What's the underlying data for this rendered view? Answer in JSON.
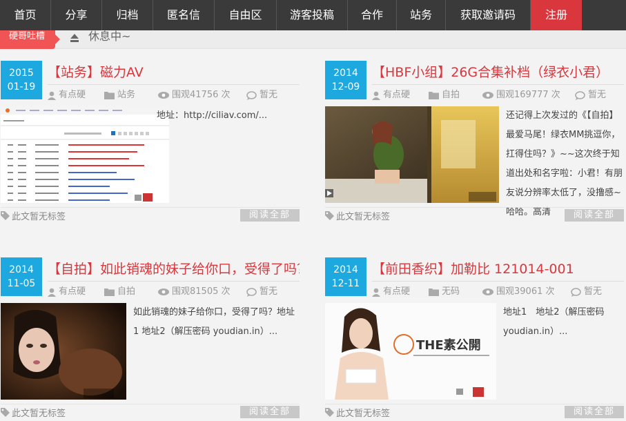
{
  "nav": {
    "items": [
      "首页",
      "分享",
      "归档",
      "匿名信",
      "自由区",
      "游客投稿",
      "合作",
      "站务",
      "获取邀请码",
      "注册"
    ]
  },
  "notice": {
    "tag": "硬哥吐槽",
    "text": "休息中~"
  },
  "labels": {
    "no_tags": "此文暂无标签",
    "read_all": "阅读全部"
  },
  "posts": [
    {
      "year": "2015",
      "day": "01-19",
      "title": "【站务】磁力AV",
      "author": "有点硬",
      "category": "站务",
      "views": "围观41756 次",
      "comments": "暂无",
      "excerpt": "地址：http://ciliav.com/..."
    },
    {
      "year": "2014",
      "day": "12-09",
      "title": "【HBF小组】26G合集补档（绿衣小君）",
      "author": "有点硬",
      "category": "自拍",
      "views": "围观169777 次",
      "comments": "暂无",
      "excerpt": "还记得上次发过的《【自拍】最爱马尾！绿衣MM挑逗你，扛得住吗？》~~这次终于知道出处和名字啦：小君！有朋友说分辨率太低了，没撸感~哈哈。高清"
    },
    {
      "year": "2014",
      "day": "11-05",
      "title": "【自拍】如此销魂的妹子给你口，受得了吗？",
      "author": "有点硬",
      "category": "自拍",
      "views": "围观81505 次",
      "comments": "暂无",
      "excerpt": "如此销魂的妹子给你口，受得了吗？地址1 地址2（解压密码 youdian.in）..."
    },
    {
      "year": "2014",
      "day": "12-11",
      "title": "【前田香织】加勒比 121014-001",
      "author": "有点硬",
      "category": "无码",
      "views": "围观39061 次",
      "comments": "暂无",
      "excerpt": "地址1　地址2（解压密码 youdian.in）..."
    }
  ],
  "thumb3": {
    "brand": "THE素公開"
  },
  "colors": {
    "accent": "#d9373d",
    "date": "#1da8e0",
    "nav": "#3a3a3a"
  }
}
